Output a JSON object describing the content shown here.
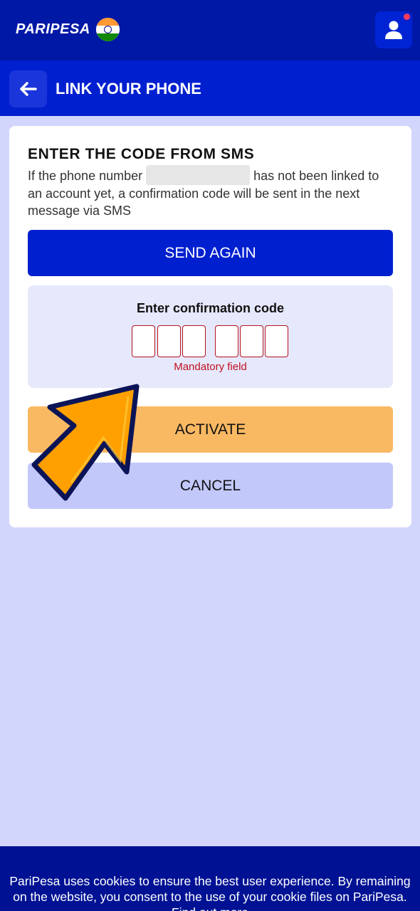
{
  "header": {
    "brand": "PARIPESA",
    "flag_icon": "india-flag-icon",
    "user_icon": "user-icon",
    "notification_color": "#ff3b5c"
  },
  "titlebar": {
    "back_icon": "arrow-left-icon",
    "title": "LINK YOUR PHONE"
  },
  "card": {
    "heading": "ENTER THE CODE FROM SMS",
    "desc_before": "If the phone number ",
    "desc_after": " has not been linked to an account yet, a confirmation code will be sent in the next message via SMS",
    "send_again_label": "SEND AGAIN",
    "code_label": "Enter confirmation code",
    "code_digits": [
      "",
      "",
      "",
      "",
      "",
      ""
    ],
    "mandatory_text": "Mandatory field",
    "activate_label": "ACTIVATE",
    "cancel_label": "CANCEL"
  },
  "overlay": {
    "arrow_icon": "pointer-arrow-icon"
  },
  "cookie": {
    "text": "PariPesa uses cookies to ensure the best user experience. By remaining on the website, you consent to the use of your cookie files on PariPesa.",
    "link_label": "Find out more"
  },
  "colors": {
    "header_bg": "#0018a6",
    "titlebar_bg": "#0020d0",
    "page_bg": "#d3d6fc",
    "primary_button": "#0020d0",
    "activate_button": "#f9b862",
    "cancel_button": "#c3c8fb",
    "error_red": "#c0111f"
  }
}
